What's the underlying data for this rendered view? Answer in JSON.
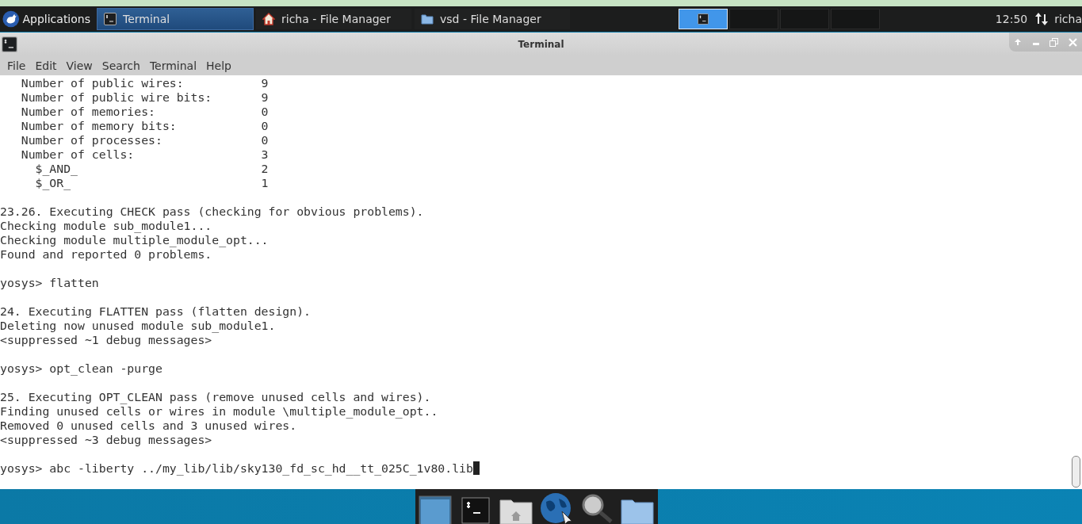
{
  "panel": {
    "menu_label": "Applications",
    "tasks": [
      {
        "label": "Terminal",
        "kind": "terminal",
        "selected": true
      },
      {
        "label": "richa - File Manager",
        "kind": "home",
        "selected": false
      },
      {
        "label": "vsd - File Manager",
        "kind": "folder",
        "selected": false
      }
    ],
    "workspaces": [
      {
        "selected": true
      },
      {
        "selected": false
      },
      {
        "selected": false
      },
      {
        "selected": false
      }
    ],
    "clock": "12:50",
    "user": "richa"
  },
  "window": {
    "title": "Terminal",
    "menu": [
      "File",
      "Edit",
      "View",
      "Search",
      "Terminal",
      "Help"
    ]
  },
  "terminal": {
    "blocks": [
      [
        "   Number of public wires:           9",
        "   Number of public wire bits:       9",
        "   Number of memories:               0",
        "   Number of memory bits:            0",
        "   Number of processes:              0",
        "   Number of cells:                  3",
        "     $_AND_                          2",
        "     $_OR_                           1"
      ],
      [
        "23.26. Executing CHECK pass (checking for obvious problems).",
        "Checking module sub_module1...",
        "Checking module multiple_module_opt...",
        "Found and reported 0 problems."
      ],
      [
        "yosys> flatten"
      ],
      [
        "24. Executing FLATTEN pass (flatten design).",
        "Deleting now unused module sub_module1.",
        "<suppressed ~1 debug messages>"
      ],
      [
        "yosys> opt_clean -purge"
      ],
      [
        "25. Executing OPT_CLEAN pass (remove unused cells and wires).",
        "Finding unused cells or wires in module \\multiple_module_opt..",
        "Removed 0 unused cells and 3 unused wires.",
        "<suppressed ~3 debug messages>"
      ],
      [
        "yosys> abc -liberty ../my_lib/lib/sky130_fd_sc_hd__tt_025C_1v80.lib"
      ]
    ],
    "cursor": true
  },
  "dock": [
    {
      "kind": "desktop"
    },
    {
      "kind": "terminal"
    },
    {
      "kind": "home"
    },
    {
      "kind": "globe"
    },
    {
      "kind": "search"
    },
    {
      "kind": "folder"
    }
  ]
}
